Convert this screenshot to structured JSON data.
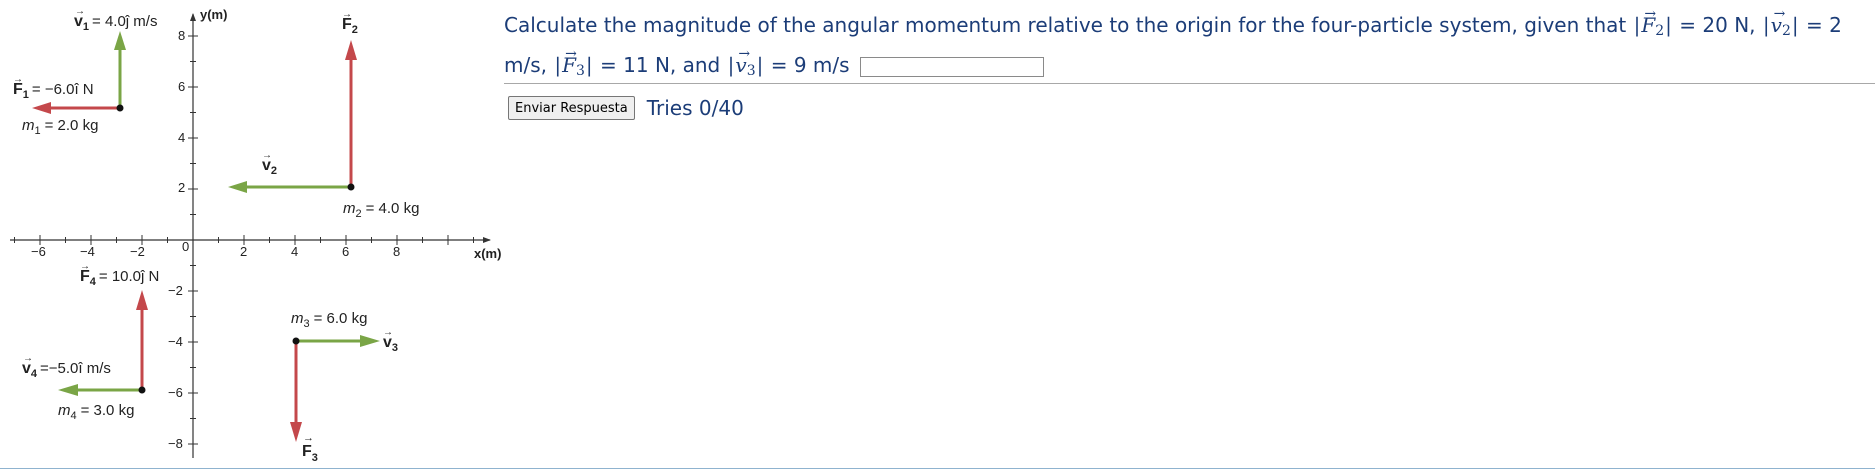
{
  "figure": {
    "axis_x_label": "x(m)",
    "axis_y_label": "y(m)",
    "origin_label": "0",
    "x_ticks": [
      "−6",
      "−4",
      "−2",
      "2",
      "4",
      "6",
      "8"
    ],
    "y_ticks": [
      "8",
      "6",
      "4",
      "2",
      "−2",
      "−4",
      "−6",
      "−8"
    ],
    "vectors": {
      "v1": "v",
      "v1_sub": "1",
      "v1_value": "= 4.0ĵ m/s",
      "F1": "F",
      "F1_sub": "1",
      "F1_value": "= −6.0î N",
      "m1": "m",
      "m1_sub": "1",
      "m1_value": "= 2.0 kg",
      "F2": "F",
      "F2_sub": "2",
      "v2": "v",
      "v2_sub": "2",
      "m2": "m",
      "m2_sub": "2",
      "m2_value": "= 4.0 kg",
      "F4": "F",
      "F4_sub": "4",
      "F4_value": "= 10.0ĵ N",
      "m3": "m",
      "m3_sub": "3",
      "m3_value": "= 6.0 kg",
      "v3": "v",
      "v3_sub": "3",
      "v4": "v",
      "v4_sub": "4",
      "v4_value": "=−5.0î m/s",
      "m4": "m",
      "m4_sub": "4",
      "m4_value": "= 3.0 kg",
      "F3": "F",
      "F3_sub": "3"
    },
    "colors": {
      "velocity": "#7aa546",
      "force": "#c4484b",
      "axis": "#333333"
    }
  },
  "question": {
    "text_1": "Calculate the magnitude of the angular momentum relative to the origin for the four-particle system, given that",
    "bar": "|",
    "F_symbol": "F",
    "v_symbol": "v",
    "arrow": "→",
    "sub_2": "2",
    "sub_3": "3",
    "eq_F2": "= 20 N,",
    "eq_v2": "= 2 m/s,",
    "eq_F3": "= 11 N, and",
    "eq_v3": "= 9 m/s",
    "answer_value": ""
  },
  "submit": {
    "label": "Enviar Respuesta",
    "tries": "Tries 0/40"
  }
}
